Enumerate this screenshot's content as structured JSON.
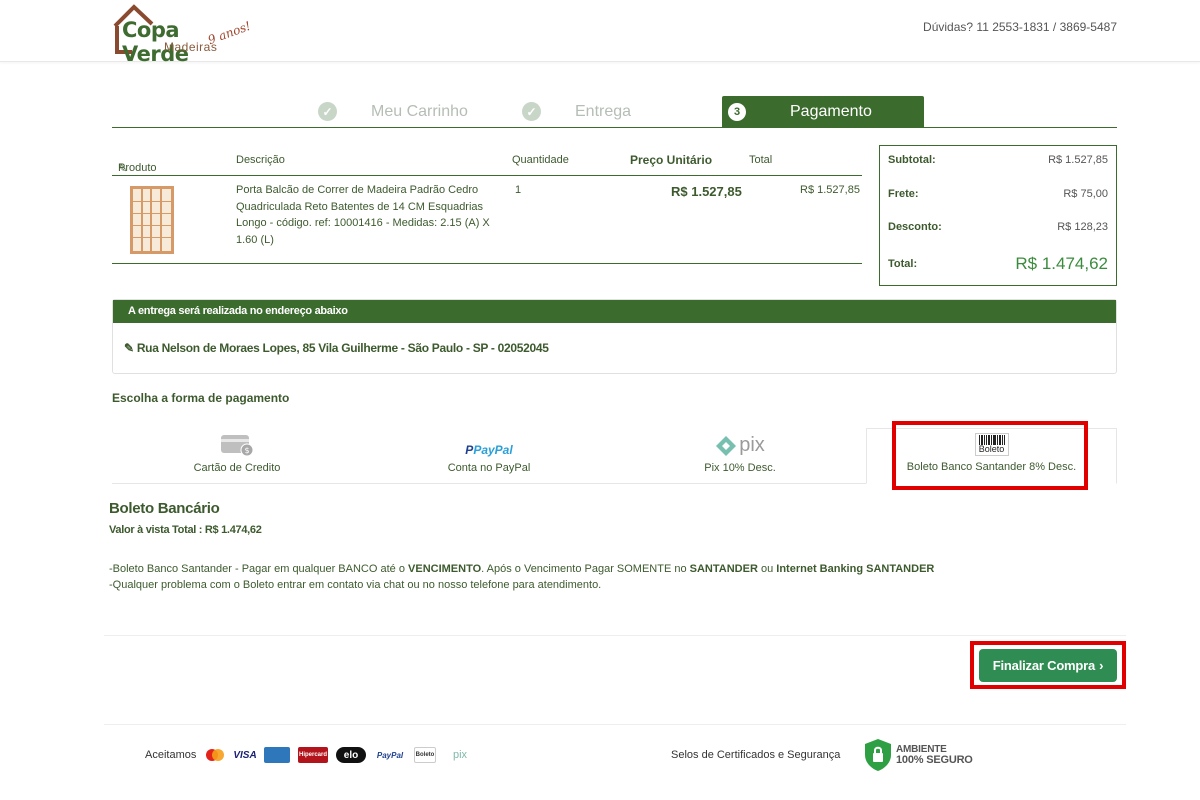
{
  "header": {
    "logo_name": "Copa Verde",
    "logo_sub": "Madeiras",
    "logo_years": "9 anos!",
    "contact_label": "Dúvidas?",
    "contact_phones": "11 2553-1831 / 3869-5487"
  },
  "steps": [
    {
      "label": "Meu Carrinho",
      "state": "done"
    },
    {
      "label": "Entrega",
      "state": "done"
    },
    {
      "label": "Pagamento",
      "number": "3",
      "state": "active"
    }
  ],
  "cart": {
    "headers": {
      "product": "Produto",
      "description": "Descrição",
      "quantity": "Quantidade",
      "unit_price": "Preço Unitário",
      "total": "Total"
    },
    "item": {
      "description": "Porta Balcão de Correr de Madeira Padrão Cedro Quadriculada Reto Batentes de 14 CM Esquadrias Longo - código. ref: 10001416 - Medidas: 2.15 (A) X 1.60 (L)",
      "quantity": "1",
      "unit_price": "R$ 1.527,85",
      "total": "R$ 1.527,85"
    }
  },
  "summary": {
    "subtotal_label": "Subtotal:",
    "subtotal": "R$ 1.527,85",
    "frete_label": "Frete:",
    "frete": "R$ 75,00",
    "desconto_label": "Desconto:",
    "desconto": "R$ 128,23",
    "total_label": "Total:",
    "total": "R$ 1.474,62"
  },
  "delivery": {
    "heading": "A entrega será realizada no endereço abaixo",
    "address": "Rua Nelson de Moraes Lopes, 85 Vila Guilherme - São Paulo - SP - 02052045"
  },
  "payment": {
    "title": "Escolha a forma de pagamento",
    "options": [
      {
        "label": "Cartão de Credito",
        "icon": "credit-card-icon"
      },
      {
        "label": "Conta no PayPal",
        "icon": "paypal-icon",
        "logo_text": "PayPal"
      },
      {
        "label": "Pix 10% Desc.",
        "icon": "pix-icon",
        "logo_text": "pix"
      },
      {
        "label": "Boleto Banco Santander 8% Desc.",
        "icon": "boleto-icon",
        "logo_text": "Boleto",
        "selected": true
      }
    ]
  },
  "boleto": {
    "title": "Boleto Bancário",
    "valor": "Valor à vista Total : R$ 1.474,62",
    "line1_a": "-Boleto Banco Santander - Pagar em qualquer BANCO até o ",
    "line1_b": "VENCIMENTO",
    "line1_c": ". Após o Vencimento Pagar SOMENTE no ",
    "line1_d": "SANTANDER",
    "line1_e": " ou ",
    "line1_f": "Internet Banking SANTANDER",
    "line2": "-Qualquer problema com o Boleto entrar em contato via chat ou no nosso telefone para atendimento."
  },
  "finalize_label": "Finalizar Compra",
  "footer": {
    "accepted_label": "Aceitamos",
    "brands": [
      "MasterCard",
      "VISA",
      "AMERICAN EXPRESS",
      "Hipercard",
      "elo",
      "PayPal",
      "Boleto",
      "pix"
    ],
    "seals_label": "Selos de Certificados e Segurança",
    "secure_line1": "AMBIENTE",
    "secure_line2": "100% SEGURO"
  },
  "colors": {
    "brand_green": "#3b6b2d",
    "button_green": "#2f8c52",
    "highlight_red": "#e00000"
  }
}
